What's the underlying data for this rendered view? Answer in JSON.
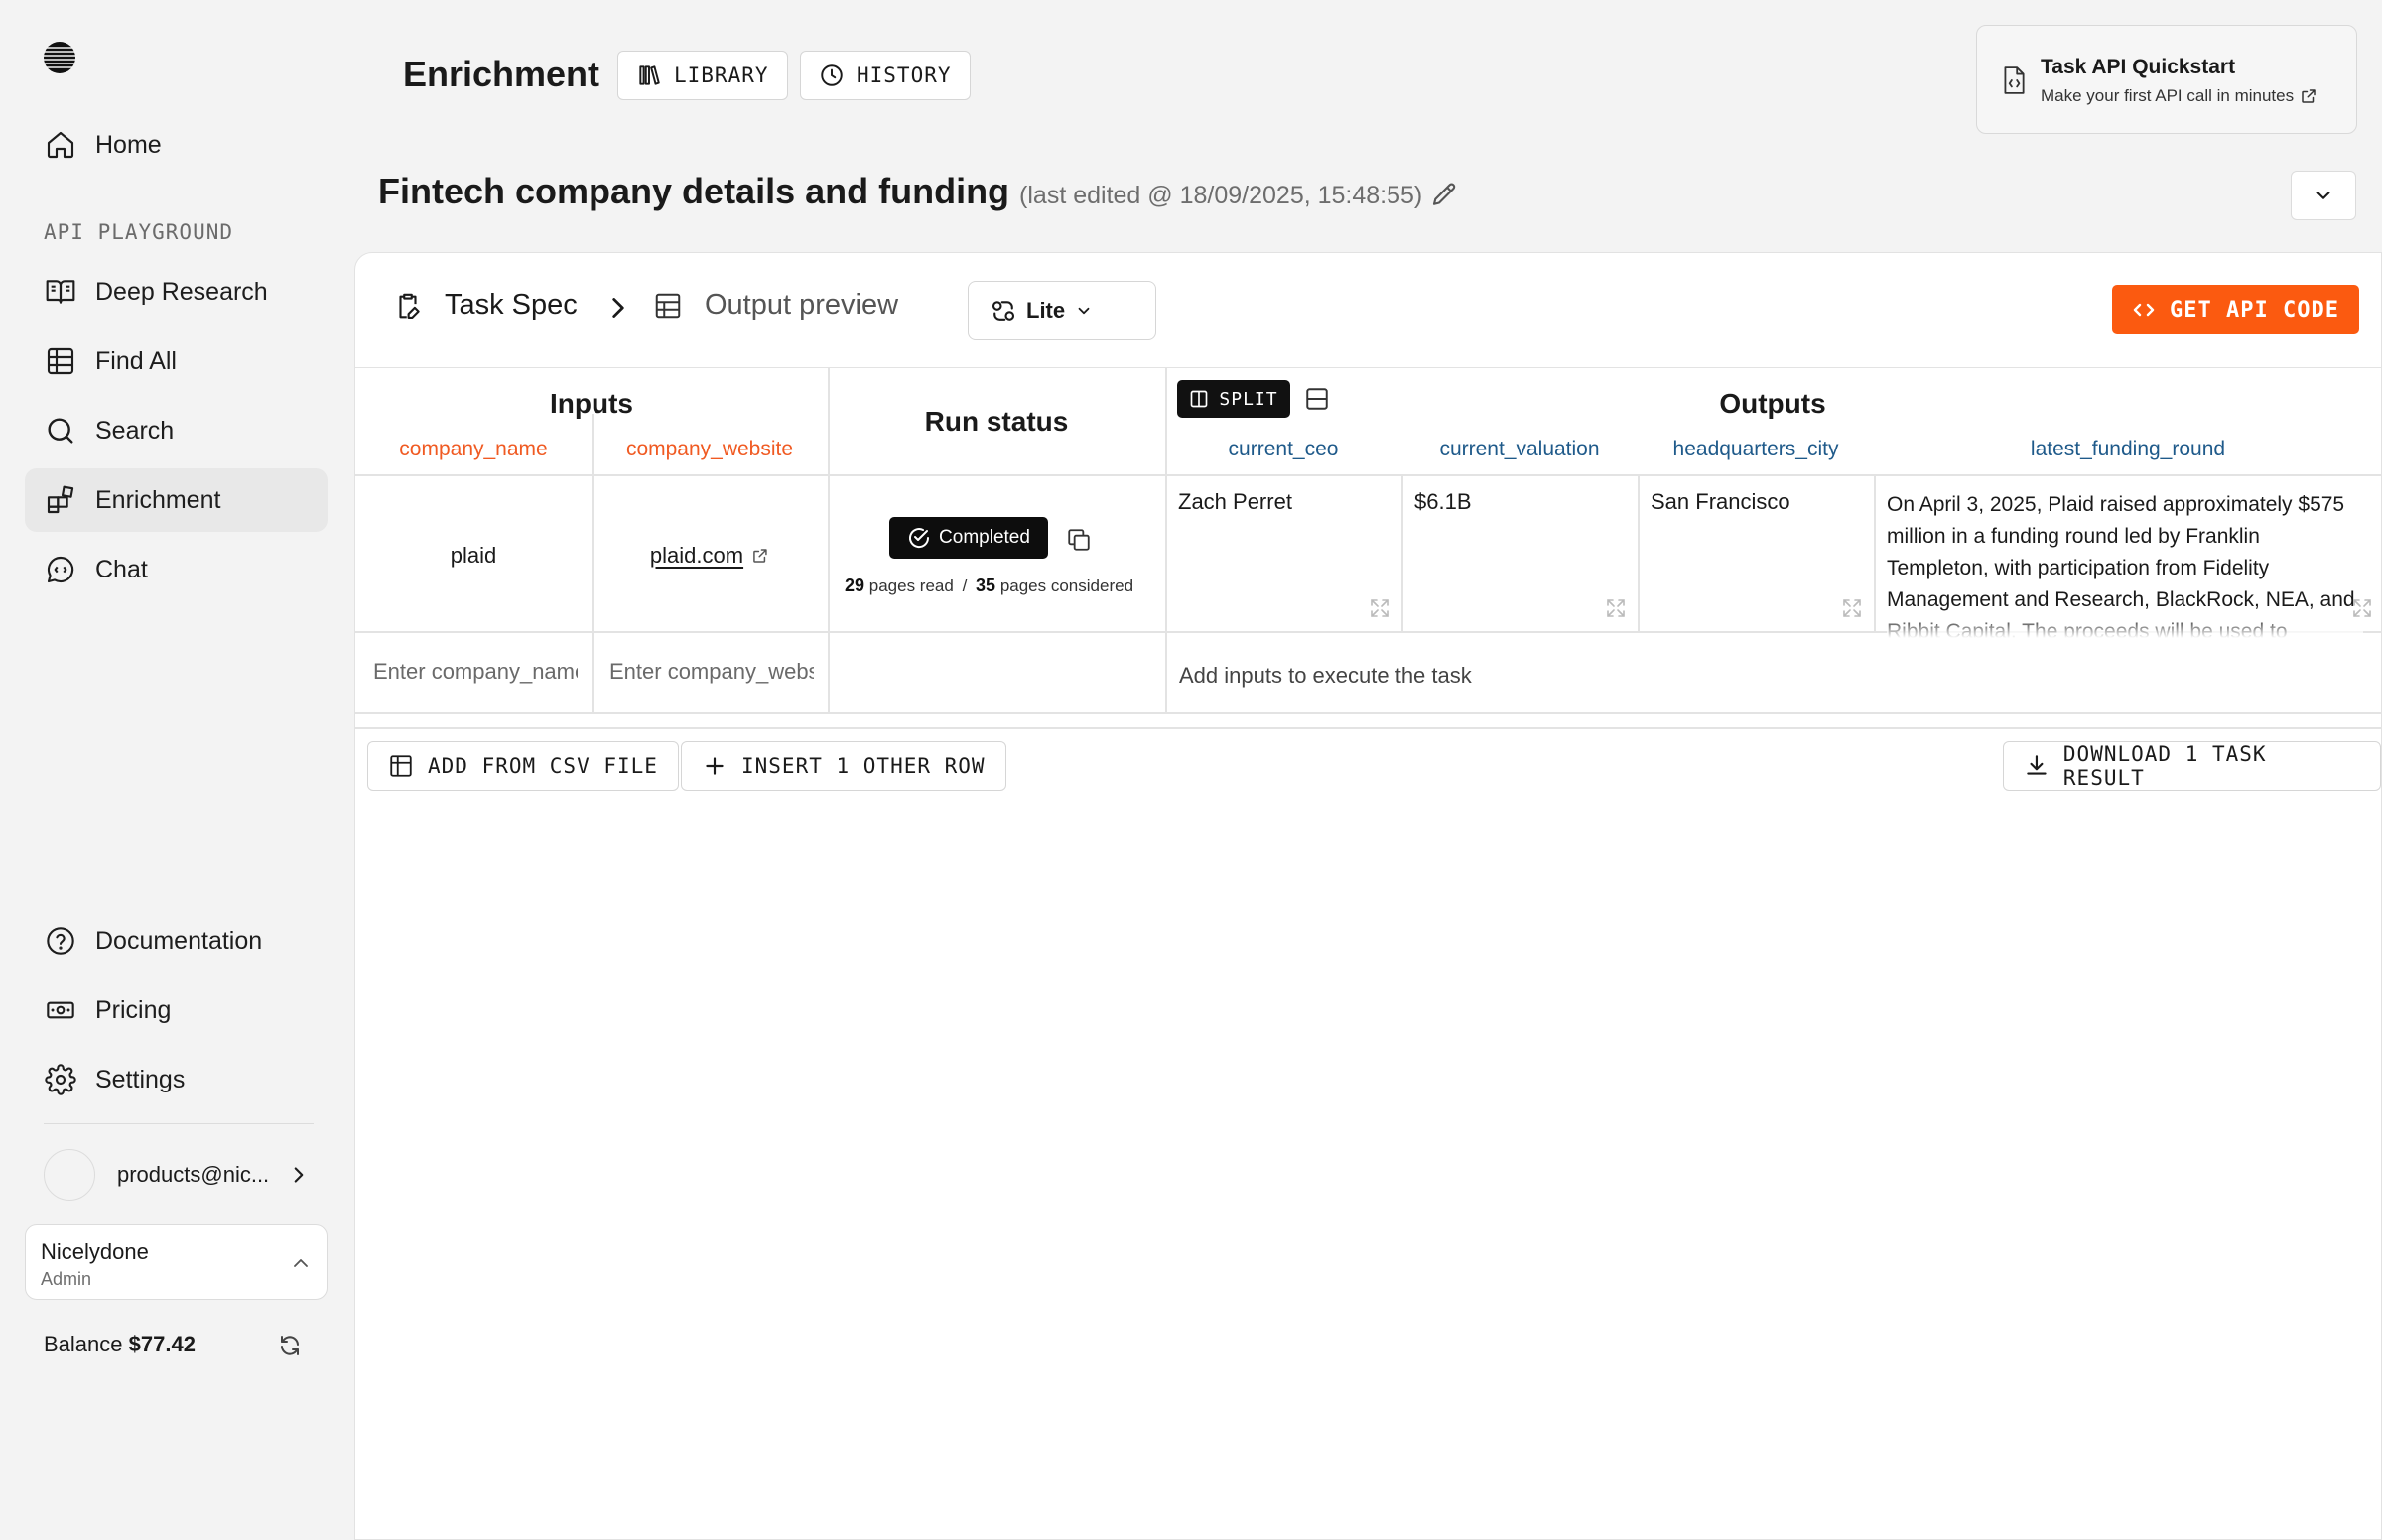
{
  "sidebar": {
    "nav": [
      {
        "label": "Home",
        "icon": "home-icon"
      }
    ],
    "section_label": "API PLAYGROUND",
    "playground": [
      {
        "label": "Deep Research",
        "icon": "book-open-icon"
      },
      {
        "label": "Find All",
        "icon": "table-grid-icon"
      },
      {
        "label": "Search",
        "icon": "search-icon"
      },
      {
        "label": "Enrichment",
        "icon": "blocks-icon"
      },
      {
        "label": "Chat",
        "icon": "chat-icon"
      }
    ],
    "bottom": [
      {
        "label": "Documentation",
        "icon": "help-circle-icon"
      },
      {
        "label": "Pricing",
        "icon": "banknote-icon"
      },
      {
        "label": "Settings",
        "icon": "gear-icon"
      }
    ],
    "user_email": "products@nic...",
    "org_name": "Nicelydone",
    "org_role": "Admin",
    "balance_label": "Balance",
    "balance_value": "$77.42"
  },
  "header": {
    "title": "Enrichment",
    "library_label": "LIBRARY",
    "history_label": "HISTORY",
    "quickstart_title": "Task API Quickstart",
    "quickstart_sub": "Make your first API call in minutes"
  },
  "task": {
    "title": "Fintech company details and funding",
    "edited": "(last edited @ 18/09/2025, 15:48:55)"
  },
  "toolbar": {
    "task_spec": "Task Spec",
    "output_preview": "Output preview",
    "processor": "Lite",
    "api_button": "GET API CODE"
  },
  "table": {
    "inputs_title": "Inputs",
    "run_status_title": "Run status",
    "outputs_title": "Outputs",
    "split_label": "SPLIT",
    "input_columns": [
      "company_name",
      "company_website"
    ],
    "output_columns": [
      "current_ceo",
      "current_valuation",
      "headquarters_city",
      "latest_funding_round"
    ],
    "row": {
      "company_name": "plaid",
      "company_website": "plaid.com",
      "status": "Completed",
      "pages_read": "29",
      "pages_read_label": "pages read",
      "separator": "/",
      "pages_considered": "35",
      "pages_considered_label": "pages considered",
      "current_ceo": "Zach Perret",
      "current_valuation": "$6.1B",
      "headquarters_city": "San Francisco",
      "latest_funding_round": "On April 3, 2025, Plaid raised approximately $575 million in a funding round led by Franklin Templeton, with participation from Fidelity Management and Research, BlackRock, NEA, and Ribbit Capital. The proceeds will be used to address employee tax"
    },
    "new_row": {
      "company_name_placeholder": "Enter company_name",
      "company_website_placeholder": "Enter company_website",
      "hint": "Add inputs to execute the task"
    }
  },
  "footer": {
    "csv_label": "ADD FROM CSV FILE",
    "insert_label": "INSERT 1 OTHER ROW",
    "download_label": "DOWNLOAD 1 TASK RESULT"
  },
  "colors": {
    "accent": "#fb5a10",
    "input_column": "#f05a22",
    "output_column": "#1f5a8a"
  }
}
